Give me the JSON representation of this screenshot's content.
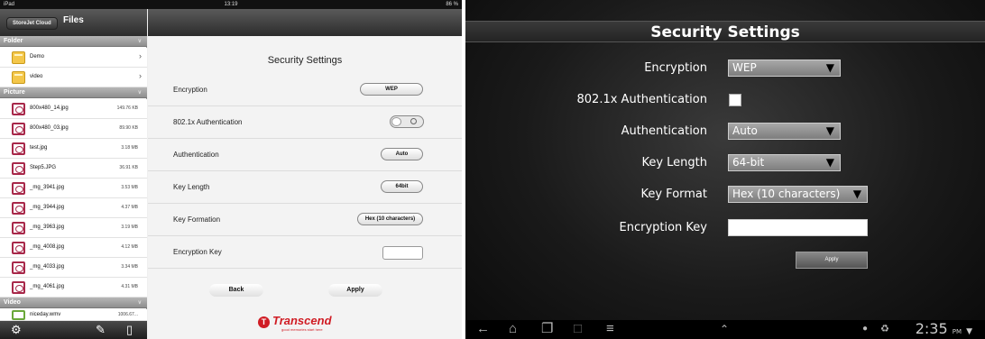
{
  "ipad": {
    "status": {
      "device": "iPad",
      "time": "13:19",
      "battery": "86 %"
    },
    "left": {
      "cloud_button": "StoreJet Cloud",
      "title": "Files",
      "sections": {
        "folder": "Folder",
        "picture": "Picture",
        "video": "Video"
      },
      "folders": [
        {
          "name": "Demo"
        },
        {
          "name": "video"
        }
      ],
      "pictures": [
        {
          "name": "800x480_14.jpg",
          "size": "149.76 KB"
        },
        {
          "name": "800x480_03.jpg",
          "size": "89.90 KB"
        },
        {
          "name": "test.jpg",
          "size": "3.18 MB"
        },
        {
          "name": "Step5.JPG",
          "size": "36.91 KB"
        },
        {
          "name": "_mg_3941.jpg",
          "size": "3.53 MB"
        },
        {
          "name": "_mg_3944.jpg",
          "size": "4.37 MB"
        },
        {
          "name": "_mg_3963.jpg",
          "size": "3.19 MB"
        },
        {
          "name": "_mg_4008.jpg",
          "size": "4.12 MB"
        },
        {
          "name": "_mg_4033.jpg",
          "size": "3.34 MB"
        },
        {
          "name": "_mg_4061.jpg",
          "size": "4.31 MB"
        }
      ],
      "videos": [
        {
          "name": "niceday.wmv",
          "size": "1006.67..."
        }
      ],
      "bottom_icons": [
        "gear-icon",
        "edit-icon",
        "device-icon"
      ]
    },
    "right": {
      "title": "Security Settings",
      "rows": {
        "encryption": {
          "label": "Encryption",
          "value": "WEP"
        },
        "auth8021x": {
          "label": "802.1x Authentication",
          "enabled": false
        },
        "authentication": {
          "label": "Authentication",
          "value": "Auto"
        },
        "key_length": {
          "label": "Key Length",
          "value": "64bit"
        },
        "key_formation": {
          "label": "Key Formation",
          "value": "Hex (10 characters)"
        },
        "encryption_key": {
          "label": "Encryption Key",
          "value": ""
        }
      },
      "back": "Back",
      "apply": "Apply",
      "logo": {
        "brand": "Transcend",
        "tagline": "good memories start here"
      }
    }
  },
  "android": {
    "title": "Security Settings",
    "encryption": {
      "label": "Encryption",
      "value": "WEP"
    },
    "auth8021x": {
      "label": "802.1x Authentication",
      "checked": false
    },
    "authentication": {
      "label": "Authentication",
      "value": "Auto"
    },
    "key_length": {
      "label": "Key Length",
      "value": "64-bit"
    },
    "key_format": {
      "label": "Key Format",
      "value": "Hex (10 characters)"
    },
    "encryption_key": {
      "label": "Encryption Key",
      "value": ""
    },
    "apply": "Apply",
    "clock": {
      "time": "2:35",
      "ampm": "PM"
    }
  }
}
